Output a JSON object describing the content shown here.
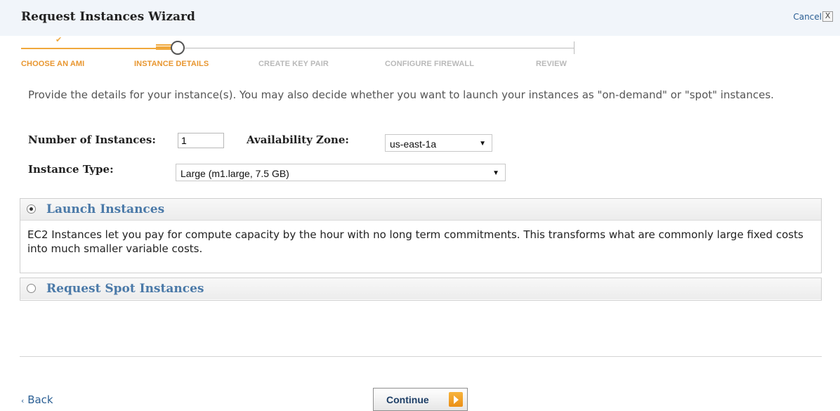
{
  "window": {
    "title": "Request Instances Wizard",
    "cancel_label": "Cancel",
    "cancel_x": "X"
  },
  "steps": {
    "choose_ami": "CHOOSE AN AMI",
    "instance_details": "INSTANCE DETAILS",
    "create_key_pair": "CREATE KEY PAIR",
    "configure_firewall": "CONFIGURE FIREWALL",
    "review": "REVIEW",
    "current_step": "INSTANCE DETAILS"
  },
  "intro": "Provide the details for your instance(s). You may also decide whether you want to launch your instances as \"on-demand\" or \"spot\" instances.",
  "form": {
    "number_of_instances_label": "Number of Instances:",
    "number_of_instances_value": "1",
    "availability_zone_label": "Availability Zone:",
    "availability_zone_value": "us-east-1a",
    "instance_type_label": "Instance Type:",
    "instance_type_value": "Large (m1.large, 7.5 GB)"
  },
  "launch_panel": {
    "title": "Launch Instances",
    "selected": true,
    "description": "EC2 Instances let you pay for compute capacity by the hour with no long term commitments. This transforms what are commonly large fixed costs into much smaller variable costs."
  },
  "spot_panel": {
    "title": "Request Spot Instances",
    "selected": false
  },
  "footer": {
    "back_label": "Back",
    "continue_label": "Continue"
  },
  "colors": {
    "accent_orange": "#e8962f",
    "link_blue": "#2b5f94",
    "panel_title_blue": "#4a79a8"
  }
}
